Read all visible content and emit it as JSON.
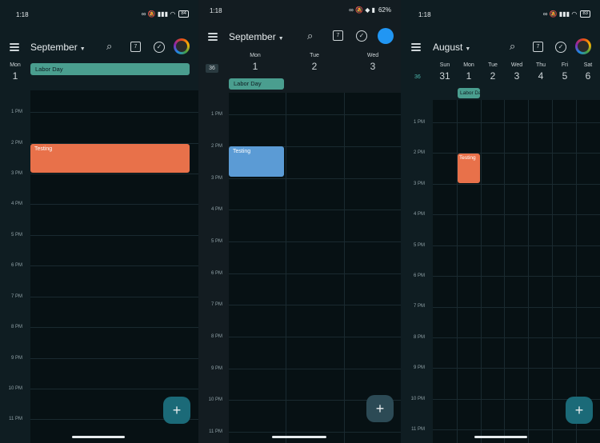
{
  "panels": [
    {
      "status": {
        "time": "1:18",
        "icons": "∞ 🔕 ▮▮▮ ◠",
        "battery": "84"
      },
      "header": {
        "month": "September"
      },
      "days": [
        {
          "name": "Mon",
          "num": "1"
        }
      ],
      "allday": {
        "label": "Labor Day"
      },
      "hours": [
        "1 PM",
        "2 PM",
        "3 PM",
        "4 PM",
        "5 PM",
        "6 PM",
        "7 PM",
        "8 PM",
        "9 PM",
        "10 PM",
        "11 PM"
      ],
      "event": {
        "label": "Testing"
      }
    },
    {
      "status": {
        "time": "1:18",
        "icons": "∞ 🔕 ◆ ▮",
        "battery": "62%"
      },
      "header": {
        "month": "September"
      },
      "weeknum": "36",
      "days": [
        {
          "name": "Mon",
          "num": "1"
        },
        {
          "name": "Tue",
          "num": "2"
        },
        {
          "name": "Wed",
          "num": "3"
        }
      ],
      "allday": {
        "label": "Labor Day"
      },
      "hours": [
        "1 PM",
        "2 PM",
        "3 PM",
        "4 PM",
        "5 PM",
        "6 PM",
        "7 PM",
        "8 PM",
        "9 PM",
        "10 PM",
        "11 PM"
      ],
      "event": {
        "label": "Testing"
      }
    },
    {
      "status": {
        "time": "1:18",
        "icons": "∞ 🔕 ▮▮▮ ◠",
        "battery": "83"
      },
      "header": {
        "month": "August"
      },
      "weeknum": "36",
      "days": [
        {
          "name": "Sun",
          "num": "31"
        },
        {
          "name": "Mon",
          "num": "1"
        },
        {
          "name": "Tue",
          "num": "2"
        },
        {
          "name": "Wed",
          "num": "3"
        },
        {
          "name": "Thu",
          "num": "4"
        },
        {
          "name": "Fri",
          "num": "5"
        },
        {
          "name": "Sat",
          "num": "6"
        }
      ],
      "allday": {
        "label": "Labor Day"
      },
      "hours": [
        "1 PM",
        "2 PM",
        "3 PM",
        "4 PM",
        "5 PM",
        "6 PM",
        "7 PM",
        "8 PM",
        "9 PM",
        "10 PM",
        "11 PM"
      ],
      "event": {
        "label": "Testing"
      }
    }
  ],
  "icons": {
    "search": "⌕",
    "calendar_day": "7",
    "tasks": "✓",
    "add": "+"
  },
  "colors": {
    "event_orange": "#e8714a",
    "event_blue": "#5b9bd5",
    "allday_teal": "#4a9e8f",
    "fab_teal": "#1b6a78",
    "fab_slate": "#2c4a55"
  }
}
